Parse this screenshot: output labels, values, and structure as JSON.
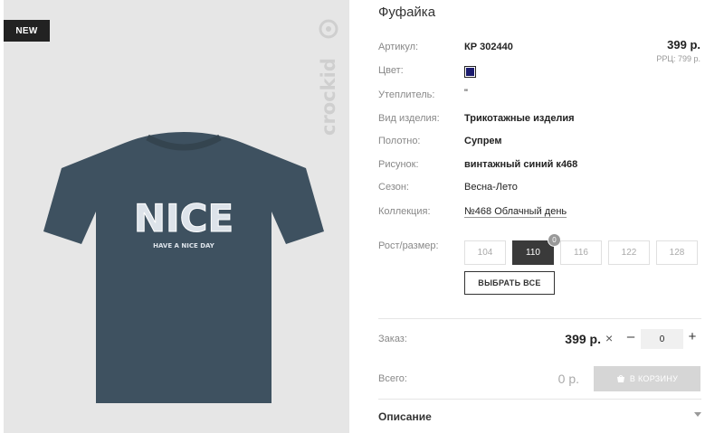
{
  "product": {
    "badge": "NEW",
    "brand": "crockid",
    "shirt_text_main": "NICE",
    "shirt_text_sub": "HAVE A NICE DAY",
    "title": "Фуфайка"
  },
  "pricing": {
    "price": "399 р.",
    "rrc": "РРЦ: 799 р."
  },
  "specs": {
    "article_label": "Артикул:",
    "article_value": "КР 302440",
    "color_label": "Цвет:",
    "color_hex": "#1b1b6e",
    "insulation_label": "Утеплитель:",
    "insulation_value": "\"",
    "type_label": "Вид изделия:",
    "type_value": "Трикотажные изделия",
    "fabric_label": "Полотно:",
    "fabric_value": "Супрем",
    "pattern_label": "Рисунок:",
    "pattern_value": "винтажный синий к468",
    "season_label": "Сезон:",
    "season_value": "Весна-Лето",
    "collection_label": "Коллекция:",
    "collection_value": "№468 Облачный день"
  },
  "sizes": {
    "label": "Рост/размер:",
    "items": [
      "104",
      "110",
      "116",
      "122",
      "128"
    ],
    "selected": "110",
    "selected_count": "0",
    "select_all": "ВЫБРАТЬ ВСЕ"
  },
  "order": {
    "label": "Заказ:",
    "price": "399 р.",
    "times": "×",
    "minus": "–",
    "qty": "0",
    "plus": "+"
  },
  "total": {
    "label": "Всего:",
    "value": "0 р.",
    "cart_button": "В КОРЗИНУ"
  },
  "description": {
    "title": "Описание"
  }
}
